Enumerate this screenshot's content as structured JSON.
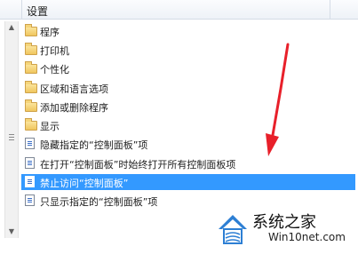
{
  "header": {
    "title": "设置"
  },
  "items": [
    {
      "label": "程序",
      "type": "folder",
      "selected": false
    },
    {
      "label": "打印机",
      "type": "folder",
      "selected": false
    },
    {
      "label": "个性化",
      "type": "folder",
      "selected": false
    },
    {
      "label": "区域和语言选项",
      "type": "folder",
      "selected": false
    },
    {
      "label": "添加或删除程序",
      "type": "folder",
      "selected": false
    },
    {
      "label": "显示",
      "type": "folder",
      "selected": false
    },
    {
      "label": "隐藏指定的“控制面板”项",
      "type": "policy",
      "selected": false
    },
    {
      "label": "在打开“控制面板”时始终打开所有控制面板项",
      "type": "policy",
      "selected": false
    },
    {
      "label": "禁止访问“控制面板”",
      "type": "policy",
      "selected": true
    },
    {
      "label": "只显示指定的“控制面板”项",
      "type": "policy",
      "selected": false
    }
  ],
  "watermark": {
    "name": "系统之家",
    "url": "Win10net.com"
  },
  "colors": {
    "selection": "#3399ff",
    "arrow": "#e8202a",
    "folder": "#f0c65e"
  },
  "icons": {
    "folder": "folder-icon",
    "policy": "policy-setting-icon",
    "scroll_up": "chevron-up-icon",
    "scroll_down": "chevron-down-icon"
  }
}
